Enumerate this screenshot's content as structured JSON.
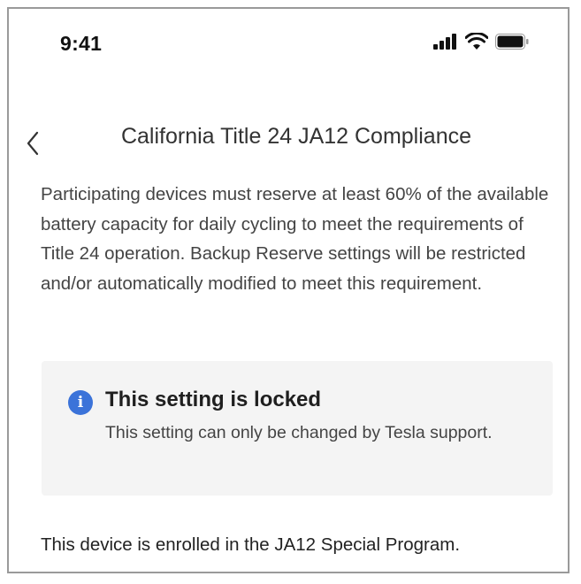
{
  "status_bar": {
    "time": "9:41",
    "icons": [
      "cellular-signal-icon",
      "wifi-icon",
      "battery-icon"
    ]
  },
  "nav": {
    "back_icon": "chevron-left-icon",
    "title": "California Title 24 JA12 Compliance"
  },
  "description": "Participating devices must reserve at least 60% of the available battery capacity for daily cycling to meet the requirements of Title 24 operation. Backup Reserve settings will be restricted and/or automatically modified to meet this requirement.",
  "info_card": {
    "icon": "info-icon",
    "icon_glyph": "i",
    "title": "This setting is locked",
    "body": "This setting can only be changed by Tesla support.",
    "accent_color": "#3b73d9",
    "background_color": "#f4f4f4"
  },
  "enrollment_text": "This device is enrolled in the JA12 Special Program."
}
